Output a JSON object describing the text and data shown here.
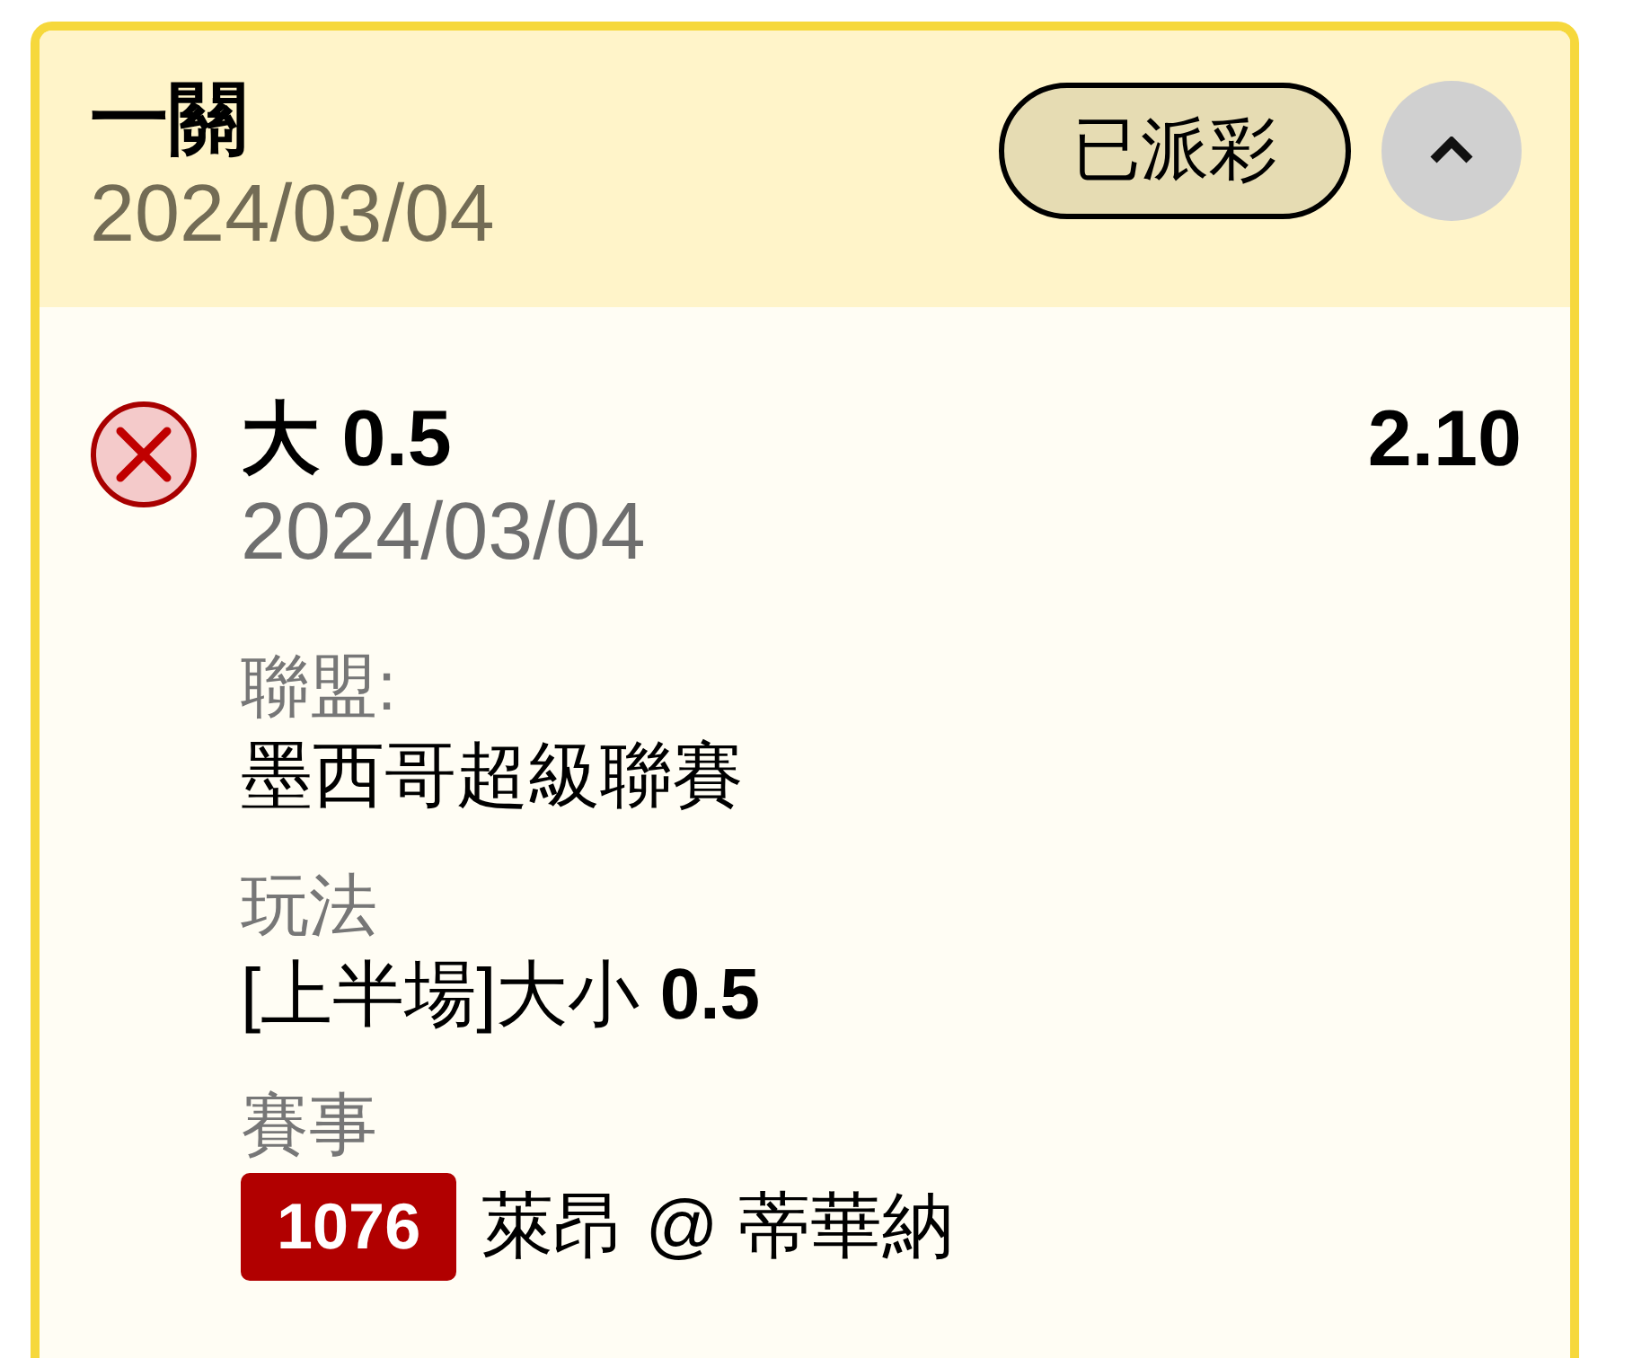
{
  "card": {
    "title": "一關",
    "date": "2024/03/04",
    "status": "已派彩",
    "expanded": true
  },
  "bets": [
    {
      "won": false,
      "selection": "大 0.5",
      "odds": "2.10",
      "date": "2024/03/04",
      "details": [
        {
          "kind": "text",
          "label": "聯盟:",
          "value": "墨西哥超級聯賽"
        },
        {
          "kind": "text",
          "label": "玩法",
          "value": "[上半場]大小 **0.5**"
        },
        {
          "kind": "match",
          "label": "賽事",
          "match_number": "1076",
          "teams": "萊昂 @ 蒂華納"
        }
      ]
    }
  ]
}
